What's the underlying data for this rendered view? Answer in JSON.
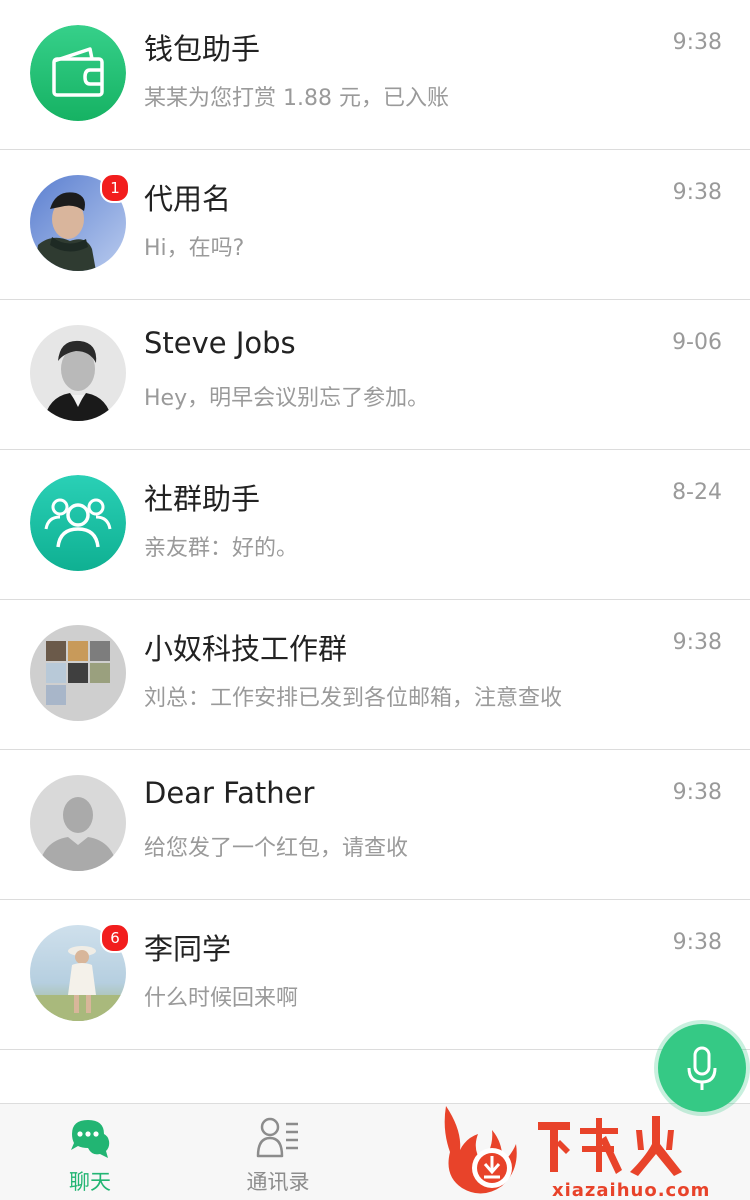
{
  "chats": [
    {
      "name": "钱包助手",
      "preview": "某某为您打赏 1.88 元，已入账",
      "time": "9:38",
      "badge": "",
      "avatar": "wallet-icon",
      "avatar_color": "#22c274"
    },
    {
      "name": "代用名",
      "preview": "Hi，在吗?",
      "time": "9:38",
      "badge": "1",
      "avatar": "person-photo-man-scarf",
      "avatar_color": "#7f9fd6"
    },
    {
      "name": "Steve Jobs",
      "preview": "Hey，明早会议别忘了参加。",
      "time": "9-06",
      "badge": "",
      "avatar": "person-photo-bw-man",
      "avatar_color": "#e0e0e0"
    },
    {
      "name": "社群助手",
      "preview": "亲友群：好的。",
      "time": "8-24",
      "badge": "",
      "avatar": "group-icon",
      "avatar_color": "#18bfa4"
    },
    {
      "name": "小奴科技工作群",
      "preview": "刘总：工作安排已发到各位邮箱，注意查收",
      "time": "9:38",
      "badge": "",
      "avatar": "group-collage",
      "avatar_color": "#cfcfcf"
    },
    {
      "name": "Dear Father",
      "preview": "给您发了一个红包，请查收",
      "time": "9:38",
      "badge": "",
      "avatar": "default-person-icon",
      "avatar_color": "#d8d8d8"
    },
    {
      "name": "李同学",
      "preview": "什么时候回来啊",
      "time": "9:38",
      "badge": "6",
      "avatar": "person-photo-woman-field",
      "avatar_color": "#a9c7d9"
    }
  ],
  "tabs": [
    {
      "label": "聊天",
      "icon": "chat-bubble-icon",
      "active": true
    },
    {
      "label": "通讯录",
      "icon": "contacts-icon",
      "active": false
    }
  ],
  "fab": {
    "icon": "microphone-icon",
    "color": "#35c985"
  },
  "watermark": {
    "brand": "下载火",
    "url": "xiazaihuo.com",
    "color": "#e8432a"
  },
  "colors": {
    "accent": "#22b573",
    "badge": "#f21d1d",
    "divider": "#dcdcdc"
  }
}
